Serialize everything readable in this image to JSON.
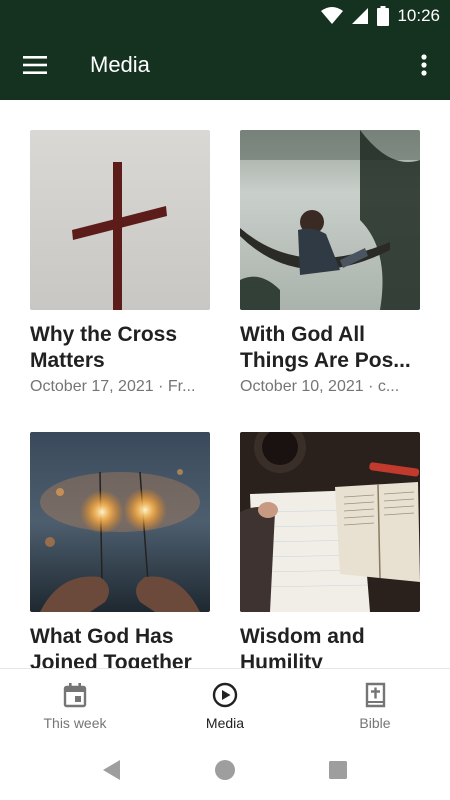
{
  "status_bar": {
    "time": "10:26"
  },
  "app_bar": {
    "title": "Media",
    "menu_icon": "hamburger-menu-icon",
    "more_icon": "more-vertical-icon"
  },
  "media": [
    {
      "title": "Why the Cross Matters",
      "subtitle": "October 17, 2021 · Fr..."
    },
    {
      "title": "With God All Things Are Pos...",
      "subtitle": "October 10, 2021 · c..."
    },
    {
      "title": "What God Has Joined Together",
      "subtitle": ""
    },
    {
      "title": "Wisdom and Humility",
      "subtitle": ""
    }
  ],
  "bottom_nav": {
    "items": [
      {
        "label": "This week",
        "icon": "calendar-icon",
        "active": false
      },
      {
        "label": "Media",
        "icon": "play-circle-icon",
        "active": true
      },
      {
        "label": "Bible",
        "icon": "bible-icon",
        "active": false
      }
    ]
  },
  "colors": {
    "app_bar": "#14321f",
    "inactive": "#757575",
    "active": "#212121"
  }
}
